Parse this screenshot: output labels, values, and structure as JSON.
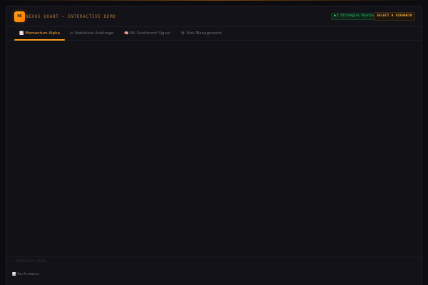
{
  "header": {
    "logo_text": "NQ",
    "title": "NEXUS QUANT — INTERACTIVE DEMO",
    "status_badge": "3 Strategies Running",
    "status_dot": "●",
    "scenario_button": "SELECT A SCENARIO",
    "colors": {
      "accent": "#ff9a1a",
      "status": "#33d17a"
    }
  },
  "tabs": [
    {
      "icon": "📈",
      "label": "Momentum Alpha",
      "active": true
    },
    {
      "icon": "⚖",
      "label": "Statistical Arbitrage",
      "active": false
    },
    {
      "icon": "🧠",
      "label": "ML Sentiment Signal",
      "active": false
    },
    {
      "icon": "🛡",
      "label": "Risk Management",
      "active": false
    }
  ],
  "feed": {
    "label": "— STRATEGY FEED",
    "performance_icon": "📊",
    "performance_label": "Performance"
  }
}
